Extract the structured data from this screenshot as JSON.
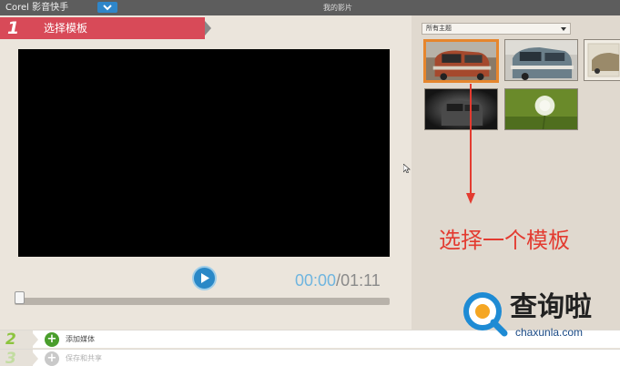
{
  "titlebar": {
    "app_title": "Corel 影音快手",
    "doc_title": "我的影片",
    "menu_icon": "chevron-down-icon"
  },
  "step1": {
    "number": "1",
    "label": "选择模板"
  },
  "player": {
    "play_icon": "play-icon",
    "time_current": "00:00",
    "time_separator": "/",
    "time_total": "01:11",
    "progress": 0
  },
  "theme_panel": {
    "selected_theme": "所有主题",
    "thumbnails": [
      {
        "label": "",
        "selected": true
      },
      {
        "label": "",
        "selected": false
      },
      {
        "label": "",
        "selected": false
      },
      {
        "label": "",
        "selected": false
      },
      {
        "label": "",
        "selected": false
      }
    ]
  },
  "steps": [
    {
      "number": "2",
      "label": "添加媒体",
      "icon": "add-icon"
    },
    {
      "number": "3",
      "label": "保存和共享",
      "icon": "share-icon"
    }
  ],
  "annotation": {
    "text": "选择一个模板",
    "color": "#e33b30"
  },
  "watermark": {
    "title": "查询啦",
    "url": "chaxunla.com"
  },
  "colors": {
    "step1_accent": "#d84a58",
    "play_button": "#2a88c7",
    "selected_border": "#e6862d",
    "step_number": "#8cc43e"
  }
}
